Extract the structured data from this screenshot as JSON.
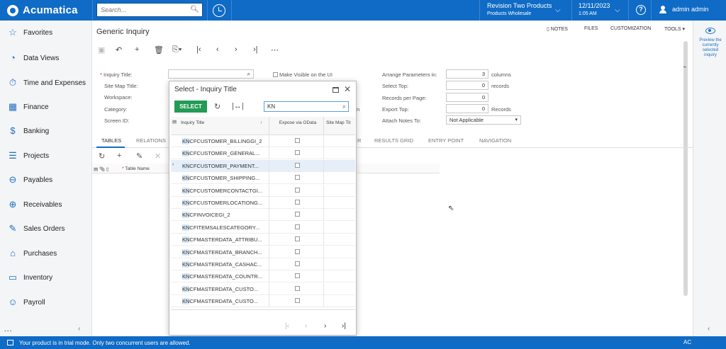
{
  "app": {
    "brand": "Acumatica"
  },
  "topbar": {
    "search_placeholder": "Search...",
    "company_name": "Revision Two Products",
    "company_sub": "Products Wholesale",
    "date": "12/11/2023",
    "time": "1:05 AM",
    "user": "admin admin"
  },
  "sidebar": {
    "items": [
      {
        "label": "Favorites",
        "icon": "star-icon"
      },
      {
        "label": "Data Views",
        "icon": "pie-chart-icon"
      },
      {
        "label": "Time and Expenses",
        "icon": "timer-icon"
      },
      {
        "label": "Finance",
        "icon": "calculator-icon"
      },
      {
        "label": "Banking",
        "icon": "dollar-icon"
      },
      {
        "label": "Projects",
        "icon": "projects-icon"
      },
      {
        "label": "Payables",
        "icon": "minus-circle-icon"
      },
      {
        "label": "Receivables",
        "icon": "plus-circle-icon"
      },
      {
        "label": "Sales Orders",
        "icon": "pencil-icon"
      },
      {
        "label": "Purchases",
        "icon": "cart-icon"
      },
      {
        "label": "Inventory",
        "icon": "truck-icon"
      },
      {
        "label": "Payroll",
        "icon": "people-icon"
      }
    ]
  },
  "page": {
    "title": "Generic Inquiry",
    "links": {
      "notes": "NOTES",
      "files": "FILES",
      "customization": "CUSTOMIZATION",
      "tools": "TOOLS"
    }
  },
  "form": {
    "inquiry_title_label": "Inquiry Title:",
    "site_map_title_label": "Site Map Title:",
    "workspace_label": "Workspace:",
    "category_label": "Category:",
    "screen_id_label": "Screen ID:",
    "make_visible_label": "Make Visible on the UI",
    "arrange_params_label": "Arrange Parameters in:",
    "arrange_params_value": "3",
    "columns_unit": "columns",
    "select_top_label": "Select Top:",
    "select_top_value": "0",
    "records_unit": "records",
    "records_per_page_label": "Records per Page:",
    "records_per_page_value": "0",
    "export_top_label": "Export Top:",
    "export_top_value": "0",
    "export_records_unit": "Records",
    "attach_notes_label": "Attach Notes To:",
    "attach_notes_value": "Not Applicable"
  },
  "tabs": {
    "tables": "TABLES",
    "relations": "RELATIONS",
    "r_fragment": "R",
    "results_grid": "RESULTS GRID",
    "entry_point": "ENTRY POINT",
    "navigation": "NAVIGATION"
  },
  "grid": {
    "table_name_header": "Table Name"
  },
  "dialog": {
    "title": "Select - Inquiry Title",
    "select_button": "SELECT",
    "search_value": "KN",
    "columns": {
      "inquiry_title": "Inquiry Title",
      "expose_via_odata": "Expose via OData",
      "site_map_title": "Site Map Tit"
    },
    "rows": [
      {
        "prefix": "KN",
        "rest": "CFCUSTOMER_BILLINGGI_2"
      },
      {
        "prefix": "KN",
        "rest": "CFCUSTOMER_GENERAL..."
      },
      {
        "prefix": "KN",
        "rest": "CFCUSTOMER_PAYMENT..."
      },
      {
        "prefix": "KN",
        "rest": "CFCUSTOMER_SHIPPING..."
      },
      {
        "prefix": "KN",
        "rest": "CFCUSTOMERCONTACTGI..."
      },
      {
        "prefix": "KN",
        "rest": "CFCUSTOMERLOCATIONG..."
      },
      {
        "prefix": "KN",
        "rest": "CFINVOICEGI_2"
      },
      {
        "prefix": "KN",
        "rest": "CFITEMSALESCATEGORY..."
      },
      {
        "prefix": "KN",
        "rest": "CFMASTERDATA_ATTRIBU..."
      },
      {
        "prefix": "KN",
        "rest": "CFMASTERDATA_BRANCH..."
      },
      {
        "prefix": "KN",
        "rest": "CFMASTERDATA_CASHAC..."
      },
      {
        "prefix": "KN",
        "rest": "CFMASTERDATA_COUNTR..."
      },
      {
        "prefix": "KN",
        "rest": "CFMASTERDATA_CUSTO..."
      },
      {
        "prefix": "KN",
        "rest": "CFMASTERDATA_CUSTO..."
      }
    ],
    "selected_row_index": 2
  },
  "right_panel": {
    "preview_text": "Preview the currently selected inquiry"
  },
  "footer": {
    "message": "Your product is in trial mode. Only two concurrent users are allowed.",
    "right_text": "AC"
  },
  "colors": {
    "brand_blue": "#0f6bc5",
    "select_green": "#239b56"
  }
}
